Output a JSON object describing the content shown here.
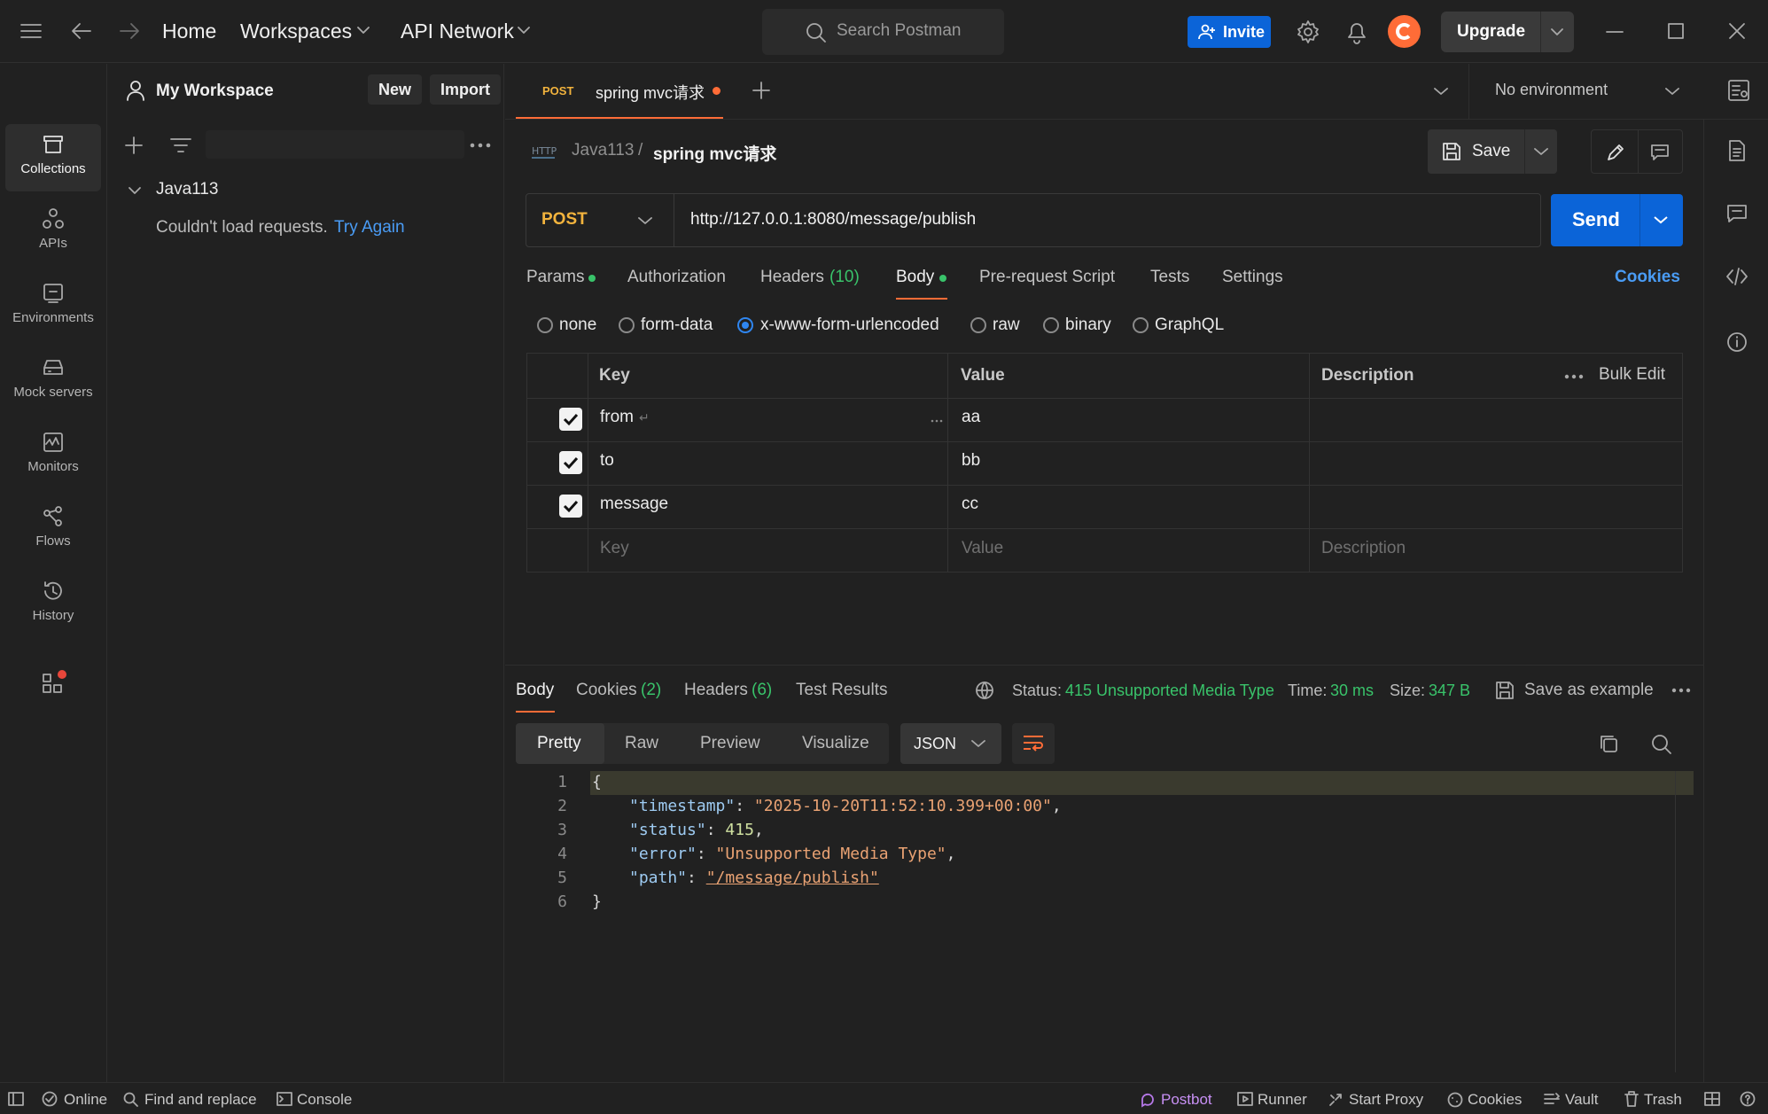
{
  "topbar": {
    "home": "Home",
    "workspaces": "Workspaces",
    "api_network": "API Network",
    "search_placeholder": "Search Postman",
    "invite": "Invite",
    "upgrade": "Upgrade"
  },
  "rail": {
    "items": [
      {
        "label": "Collections",
        "icon": "collections-icon",
        "active": true
      },
      {
        "label": "APIs",
        "icon": "apis-icon"
      },
      {
        "label": "Environments",
        "icon": "environments-icon"
      },
      {
        "label": "Mock servers",
        "icon": "mock-servers-icon"
      },
      {
        "label": "Monitors",
        "icon": "monitors-icon"
      },
      {
        "label": "Flows",
        "icon": "flows-icon"
      },
      {
        "label": "History",
        "icon": "history-icon"
      }
    ]
  },
  "sidebar": {
    "workspace_name": "My Workspace",
    "new_label": "New",
    "import_label": "Import",
    "collection_name": "Java113",
    "error_text": "Couldn't load requests.",
    "retry_link": "Try Again"
  },
  "tabs": {
    "active_method": "POST",
    "active_title": "spring mvc请求",
    "environment": "No environment"
  },
  "request": {
    "breadcrumb_parent": "Java113",
    "breadcrumb_sep": "/",
    "name": "spring mvc请求",
    "save": "Save",
    "method": "POST",
    "url": "http://127.0.0.1:8080/message/publish",
    "send": "Send",
    "tabs": {
      "params": "Params",
      "authorization": "Authorization",
      "headers": "Headers",
      "headers_count": "(10)",
      "body": "Body",
      "prerequest": "Pre-request Script",
      "tests": "Tests",
      "settings": "Settings",
      "cookies": "Cookies"
    },
    "body_types": {
      "none": "none",
      "form_data": "form-data",
      "urlencoded": "x-www-form-urlencoded",
      "raw": "raw",
      "binary": "binary",
      "graphql": "GraphQL"
    },
    "table": {
      "headers": {
        "key": "Key",
        "value": "Value",
        "description": "Description",
        "bulk_edit": "Bulk Edit"
      },
      "rows": [
        {
          "key": "from",
          "value": "aa",
          "checked": true
        },
        {
          "key": "to",
          "value": "bb",
          "checked": true
        },
        {
          "key": "message",
          "value": "cc",
          "checked": true
        }
      ],
      "placeholders": {
        "key": "Key",
        "value": "Value",
        "description": "Description"
      }
    }
  },
  "response": {
    "tabs": {
      "body": "Body",
      "cookies": "Cookies",
      "cookies_count": "(2)",
      "headers": "Headers",
      "headers_count": "(6)",
      "test_results": "Test Results"
    },
    "status_label": "Status:",
    "status_value": "415 Unsupported Media Type",
    "time_label": "Time:",
    "time_value": "30 ms",
    "size_label": "Size:",
    "size_value": "347 B",
    "save_example": "Save as example",
    "view_tabs": {
      "pretty": "Pretty",
      "raw": "Raw",
      "preview": "Preview",
      "visualize": "Visualize"
    },
    "format": "JSON",
    "code": {
      "line_numbers": [
        "1",
        "2",
        "3",
        "4",
        "5",
        "6"
      ],
      "open": "{",
      "k1": "\"timestamp\"",
      "v1": "\"2025-10-20T11:52:10.399+00:00\"",
      "k2": "\"status\"",
      "v2": "415",
      "k3": "\"error\"",
      "v3": "\"Unsupported Media Type\"",
      "k4": "\"path\"",
      "v4": "\"/message/publish\"",
      "close": "}"
    }
  },
  "statusbar": {
    "online": "Online",
    "find_replace": "Find and replace",
    "console": "Console",
    "postbot": "Postbot",
    "runner": "Runner",
    "start_proxy": "Start Proxy",
    "cookies": "Cookies",
    "vault": "Vault",
    "trash": "Trash"
  },
  "colors": {
    "accent_blue": "#0b64d8",
    "link_blue": "#4a9cf5",
    "status_green": "#39c36a",
    "method_orange": "#f2b33d",
    "tab_indicator": "#ff6c37"
  }
}
